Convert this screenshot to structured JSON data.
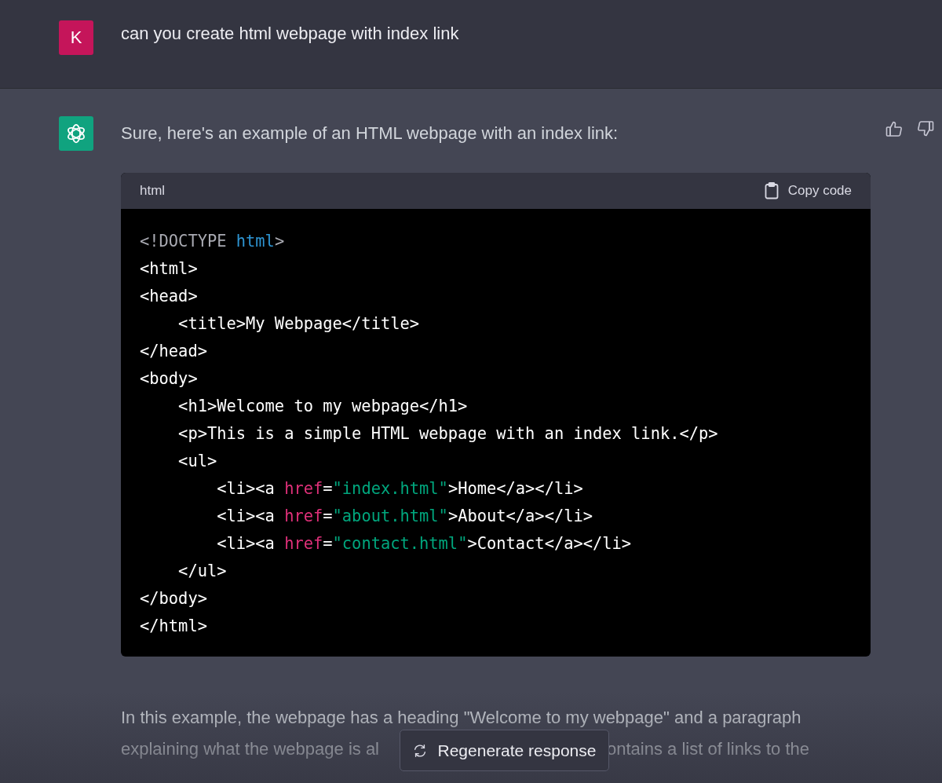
{
  "user_message": {
    "avatar": "K",
    "text": "can you create html webpage with index link"
  },
  "assistant_message": {
    "intro": "Sure, here's an example of an HTML webpage with an index link:",
    "code_block": {
      "language": "html",
      "copy_label": "Copy code",
      "lines": [
        [
          {
            "kind": "doctype",
            "text": "<!DOCTYPE "
          },
          {
            "kind": "keyword",
            "text": "html"
          },
          {
            "kind": "doctype",
            "text": ">"
          }
        ],
        [
          {
            "kind": "plain",
            "text": "<html>"
          }
        ],
        [
          {
            "kind": "plain",
            "text": "<head>"
          }
        ],
        [
          {
            "kind": "plain",
            "text": "    <title>My Webpage</title>"
          }
        ],
        [
          {
            "kind": "plain",
            "text": "</head>"
          }
        ],
        [
          {
            "kind": "plain",
            "text": "<body>"
          }
        ],
        [
          {
            "kind": "plain",
            "text": "    <h1>Welcome to my webpage</h1>"
          }
        ],
        [
          {
            "kind": "plain",
            "text": "    <p>This is a simple HTML webpage with an index link.</p>"
          }
        ],
        [
          {
            "kind": "plain",
            "text": "    <ul>"
          }
        ],
        [
          {
            "kind": "plain",
            "text": "        <li><a "
          },
          {
            "kind": "attr",
            "text": "href"
          },
          {
            "kind": "plain",
            "text": "="
          },
          {
            "kind": "string",
            "text": "\"index.html\""
          },
          {
            "kind": "plain",
            "text": ">Home</a></li>"
          }
        ],
        [
          {
            "kind": "plain",
            "text": "        <li><a "
          },
          {
            "kind": "attr",
            "text": "href"
          },
          {
            "kind": "plain",
            "text": "="
          },
          {
            "kind": "string",
            "text": "\"about.html\""
          },
          {
            "kind": "plain",
            "text": ">About</a></li>"
          }
        ],
        [
          {
            "kind": "plain",
            "text": "        <li><a "
          },
          {
            "kind": "attr",
            "text": "href"
          },
          {
            "kind": "plain",
            "text": "="
          },
          {
            "kind": "string",
            "text": "\"contact.html\""
          },
          {
            "kind": "plain",
            "text": ">Contact</a></li>"
          }
        ],
        [
          {
            "kind": "plain",
            "text": "    </ul>"
          }
        ],
        [
          {
            "kind": "plain",
            "text": "</body>"
          }
        ],
        [
          {
            "kind": "plain",
            "text": "</html>"
          }
        ]
      ]
    },
    "explanation_lines": [
      [
        "In this example, the webpage has a heading \"Welcome to my webpage\" and a paragraph"
      ],
      [
        "explaining what the webpage is al",
        "ontains a list of links to the"
      ]
    ]
  },
  "regenerate_button": {
    "label": "Regenerate response"
  }
}
